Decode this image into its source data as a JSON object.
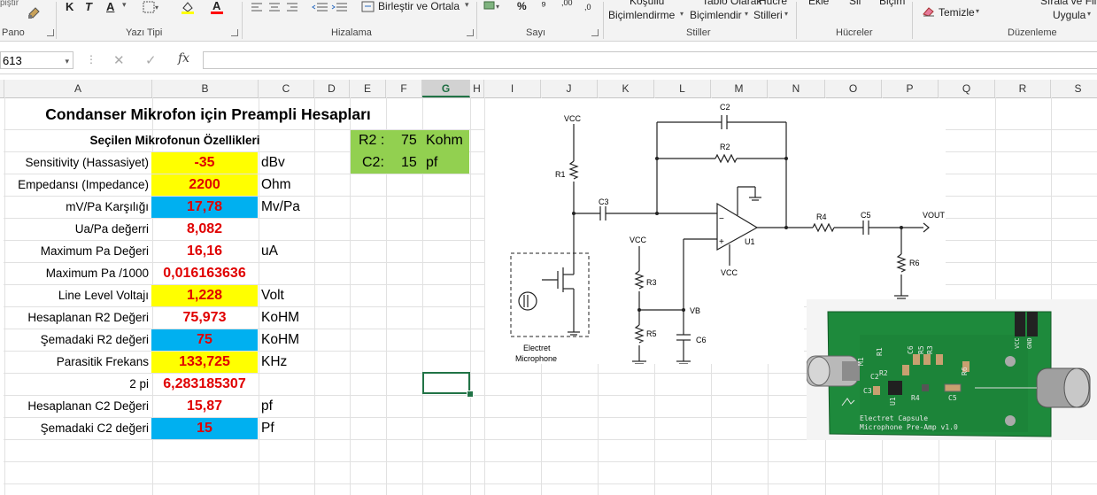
{
  "ribbon": {
    "clipboard_partial": "piştir",
    "bold": "K",
    "italic": "T",
    "underline": "A",
    "merge_center": "Birleştir ve Ortala",
    "percent": "%",
    "thousands": "⁹",
    "dec_inc": ",00",
    "dec_dec": ",0",
    "cond_format_1": "Koşullu",
    "cond_format_2": "Biçimlendirme",
    "table_format_1": "Tablo Olarak",
    "table_format_2": "Biçimlendir",
    "cell_styles_1": "Hücre",
    "cell_styles_2": "Stilleri",
    "insert": "Ekle",
    "delete": "Sil",
    "format": "Biçim",
    "clear": "Temizle",
    "sort_filter_1": "Sırala ve Filt",
    "sort_filter_2": "Uygula",
    "groups": {
      "clipboard": "Pano",
      "font": "Yazı Tipi",
      "alignment": "Hizalama",
      "number": "Sayı",
      "styles": "Stiller",
      "cells": "Hücreler",
      "editing": "Düzenleme"
    }
  },
  "formula_bar": {
    "name_box": "G13",
    "name_box_visible": "613",
    "fx": "fx",
    "cancel": "✕",
    "enter": "✓",
    "content": ""
  },
  "columns": [
    "A",
    "B",
    "C",
    "D",
    "E",
    "F",
    "G",
    "H",
    "I",
    "J",
    "K",
    "L",
    "M",
    "N",
    "O",
    "P",
    "Q",
    "R",
    "S"
  ],
  "selected_column": "G",
  "sheet": {
    "title": "Condanser Mikrofon için Preampli Hesapları",
    "subtitle": "Seçilen Mikrofonun  Özellikleri",
    "rows": [
      {
        "label": "Sensitivity (Hassasiyet)",
        "value": "-35",
        "unit": "dBv",
        "fill": "yellow"
      },
      {
        "label": "Empedansı (Impedance)",
        "value": "2200",
        "unit": "Ohm",
        "fill": "yellow"
      },
      {
        "label": "mV/Pa Karşılığı",
        "value": "17,78",
        "unit": "Mv/Pa",
        "fill": "blue"
      },
      {
        "label": "Ua/Pa değerri",
        "value": "8,082",
        "unit": "",
        "fill": "none"
      },
      {
        "label": "Maximum Pa Değeri",
        "value": "16,16",
        "unit": "uA",
        "fill": "none"
      },
      {
        "label": "Maximum Pa /1000",
        "value": "0,016163636",
        "unit": "",
        "fill": "none"
      },
      {
        "label": "Line Level Voltajı",
        "value": "1,228",
        "unit": "Volt",
        "fill": "yellow"
      },
      {
        "label": "Hesaplanan R2 Değeri",
        "value": "75,973",
        "unit": "KoHM",
        "fill": "none"
      },
      {
        "label": "Şemadaki R2 değeri",
        "value": "75",
        "unit": "KoHM",
        "fill": "blue"
      },
      {
        "label": "Parasitik Frekans",
        "value": "133,725",
        "unit": "KHz",
        "fill": "yellow"
      },
      {
        "label": "2 pi",
        "value": "6,283185307",
        "unit": "",
        "fill": "none"
      },
      {
        "label": "Hesaplanan C2 Değeri",
        "value": "15,87",
        "unit": "pf",
        "fill": "none"
      },
      {
        "label": "Şemadaki C2 değeri",
        "value": "15",
        "unit": "Pf",
        "fill": "blue"
      }
    ],
    "summary": [
      {
        "name": "R2 :",
        "value": "75",
        "unit": "Kohm"
      },
      {
        "name": "C2:",
        "value": "15",
        "unit": "pf"
      }
    ]
  },
  "schematic": {
    "labels": {
      "vcc_top": "VCC",
      "r1": "R1",
      "c3": "C3",
      "c2": "C2",
      "r2": "R2",
      "u1": "U1",
      "vcc_u1": "VCC",
      "r4": "R4",
      "c5": "C5",
      "vout": "VOUT",
      "r6": "R6",
      "vcc_mid": "VCC",
      "r3": "R3",
      "vb": "VB",
      "r5": "R5",
      "c6": "C6",
      "mic1": "Electret",
      "mic2": "Microphone"
    }
  },
  "pcb_photo": {
    "silk_1": "Electret Capsule",
    "silk_2": "Microphone Pre-Amp v1.0",
    "vcc": "VCC",
    "gnd": "GND",
    "c2": "C2",
    "r2": "R2",
    "c6": "C6",
    "r5": "R5",
    "r3": "R3",
    "r6": "R6",
    "c3": "C3",
    "c5": "C5",
    "r4": "R4",
    "u1": "U1",
    "r1": "R1",
    "m1": "M1"
  },
  "colors": {
    "yellow": "#ffff00",
    "blue": "#00b0f0",
    "green": "#92d050",
    "value_red": "#e00000",
    "excel_green": "#217346",
    "pcb_green": "#1e8a3c"
  }
}
